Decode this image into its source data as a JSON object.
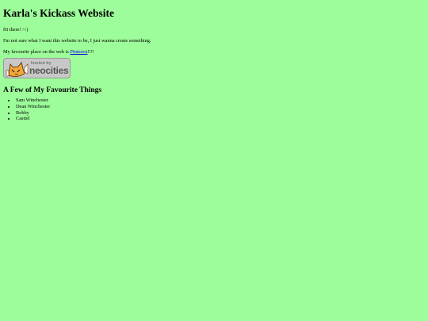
{
  "page": {
    "title": "Karla's Kickass Website",
    "greeting": "Hi there! >:)",
    "intro": "I'm not sure what I want this website to be, I just wanna create something.",
    "favourite_prefix": "My favourite place on the web is ",
    "favourite_link": "Pinterest",
    "favourite_suffix": "!!!!",
    "badge": {
      "hosted_by": "hosted by",
      "brand": "neocities",
      "icon": "neocities-cat-icon"
    },
    "list_heading": "A Few of My Favourite Things",
    "favourites": [
      "Sam Winchester",
      "Dean Winchester",
      "Bobby",
      "Castiel"
    ]
  },
  "colors": {
    "background": "#9dfd9a",
    "link": "#0000ee",
    "badge_bg": "#c8c8c8"
  }
}
